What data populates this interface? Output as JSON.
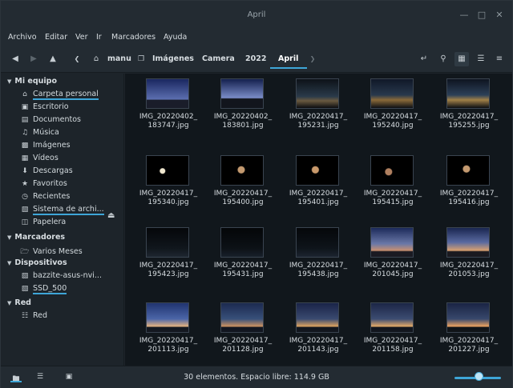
{
  "window": {
    "title": "April"
  },
  "menu": [
    "Archivo",
    "Editar",
    "Ver",
    "Ir",
    "Marcadores",
    "Ayuda"
  ],
  "breadcrumb": [
    "manu",
    "Imágenes",
    "Camera",
    "2022",
    "April"
  ],
  "sidebar": {
    "sections": [
      {
        "title": "Mi equipo",
        "items": [
          "Carpeta personal",
          "Escritorio",
          "Documentos",
          "Música",
          "Imágenes",
          "Vídeos",
          "Descargas",
          "Favoritos",
          "Recientes",
          "Sistema de archi...",
          "Papelera"
        ]
      },
      {
        "title": "Marcadores",
        "items": [
          "Varios Meses"
        ]
      },
      {
        "title": "Dispositivos",
        "items": [
          "bazzite-asus-nvi...",
          "SSD_500"
        ]
      },
      {
        "title": "Red",
        "items": [
          "Red"
        ]
      }
    ]
  },
  "files": [
    {
      "line1": "IMG_20220402_",
      "line2": "183747.jpg"
    },
    {
      "line1": "IMG_20220402_",
      "line2": "183801.jpg"
    },
    {
      "line1": "IMG_20220417_",
      "line2": "195231.jpg"
    },
    {
      "line1": "IMG_20220417_",
      "line2": "195240.jpg"
    },
    {
      "line1": "IMG_20220417_",
      "line2": "195255.jpg"
    },
    {
      "line1": "IMG_20220417_",
      "line2": "195340.jpg"
    },
    {
      "line1": "IMG_20220417_",
      "line2": "195400.jpg"
    },
    {
      "line1": "IMG_20220417_",
      "line2": "195401.jpg"
    },
    {
      "line1": "IMG_20220417_",
      "line2": "195415.jpg"
    },
    {
      "line1": "IMG_20220417_",
      "line2": "195416.jpg"
    },
    {
      "line1": "IMG_20220417_",
      "line2": "195423.jpg"
    },
    {
      "line1": "IMG_20220417_",
      "line2": "195431.jpg"
    },
    {
      "line1": "IMG_20220417_",
      "line2": "195438.jpg"
    },
    {
      "line1": "IMG_20220417_",
      "line2": "201045.jpg"
    },
    {
      "line1": "IMG_20220417_",
      "line2": "201053.jpg"
    },
    {
      "line1": "IMG_20220417_",
      "line2": "201113.jpg"
    },
    {
      "line1": "IMG_20220417_",
      "line2": "201128.jpg"
    },
    {
      "line1": "IMG_20220417_",
      "line2": "201143.jpg"
    },
    {
      "line1": "IMG_20220417_",
      "line2": "201158.jpg"
    },
    {
      "line1": "IMG_20220417_",
      "line2": "201227.jpg"
    }
  ],
  "status": {
    "text": "30 elementos. Espacio libre: 114.9 GB"
  }
}
